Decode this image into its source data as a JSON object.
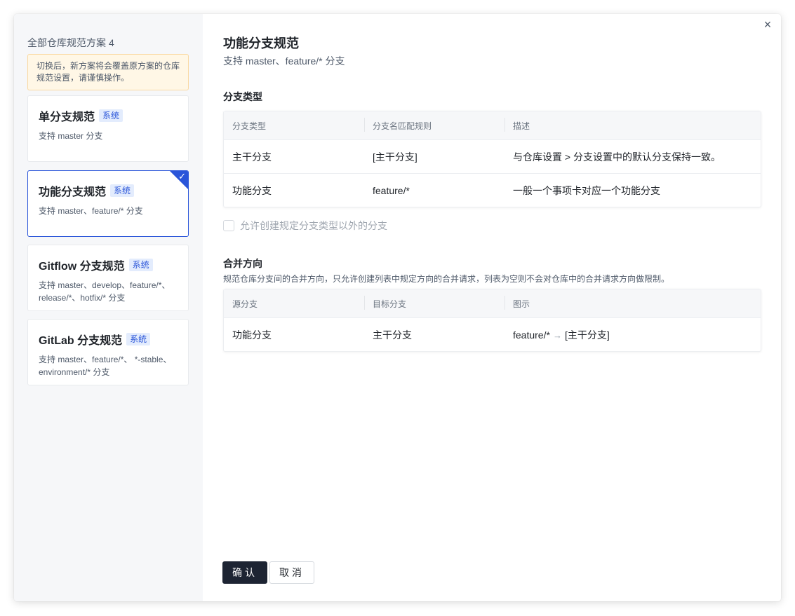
{
  "sidebar": {
    "title": "全部仓库规范方案",
    "count": "4",
    "warning": "切换后，新方案将会覆盖原方案的仓库规范设置，请谨慎操作。",
    "badge_label": "系统",
    "schemes": [
      {
        "name": "单分支规范",
        "desc": "支持 master 分支"
      },
      {
        "name": "功能分支规范",
        "desc": "支持 master、feature/* 分支"
      },
      {
        "name": "Gitflow 分支规范",
        "desc": "支持 master、develop、feature/*、release/*、hotfix/* 分支"
      },
      {
        "name": "GitLab 分支规范",
        "desc": "支持 master、feature/*、 *-stable、environment/* 分支"
      }
    ],
    "selected_index": 1
  },
  "main": {
    "close_glyph": "×",
    "title": "功能分支规范",
    "subtitle": "支持 master、feature/* 分支",
    "branch_types": {
      "title": "分支类型",
      "headers": [
        "分支类型",
        "分支名匹配规则",
        "描述"
      ],
      "rows": [
        [
          "主干分支",
          "[主干分支]",
          "与仓库设置 > 分支设置中的默认分支保持一致。"
        ],
        [
          "功能分支",
          "feature/*",
          "一般一个事项卡对应一个功能分支"
        ]
      ]
    },
    "allow_other_label": "允许创建规定分支类型以外的分支",
    "allow_other_checked": false,
    "merge": {
      "title": "合并方向",
      "desc": "规范仓库分支间的合并方向，只允许创建列表中规定方向的合并请求，列表为空则不会对仓库中的合并请求方向做限制。",
      "headers": [
        "源分支",
        "目标分支",
        "图示"
      ],
      "rows": [
        {
          "source": "功能分支",
          "target": "主干分支",
          "diagram_from": "feature/*",
          "diagram_arrow": "→",
          "diagram_to": "[主干分支]"
        }
      ]
    },
    "confirm_label": "确认",
    "cancel_label": "取消"
  }
}
